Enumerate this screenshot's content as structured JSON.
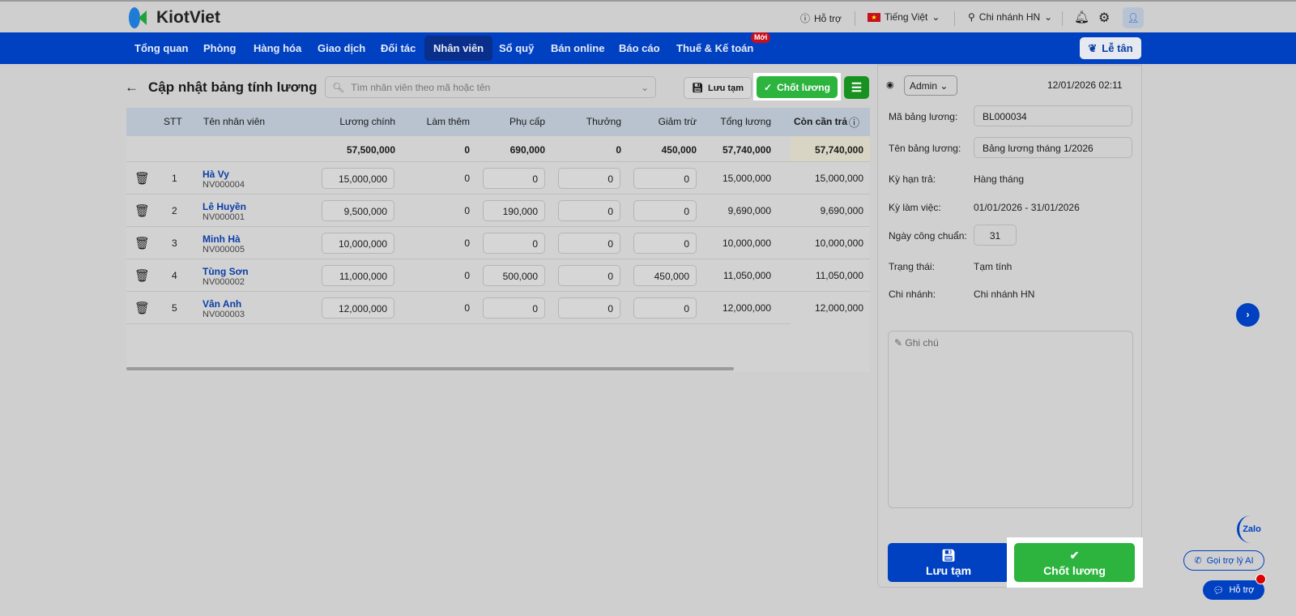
{
  "app": {
    "brand": "KiotViet",
    "support": "Hỗ trợ",
    "language": "Tiếng Việt",
    "branch": "Chi nhánh HN",
    "reception": "Lễ tân"
  },
  "nav": [
    {
      "label": "Tổng quan"
    },
    {
      "label": "Phòng"
    },
    {
      "label": "Hàng hóa"
    },
    {
      "label": "Giao dịch"
    },
    {
      "label": "Đối tác"
    },
    {
      "label": "Nhân viên",
      "active": true
    },
    {
      "label": "Sổ quỹ"
    },
    {
      "label": "Bán online"
    },
    {
      "label": "Báo cáo"
    },
    {
      "label": "Thuế & Kế toán",
      "badge": "Mới"
    }
  ],
  "page": {
    "title": "Cập nhật bảng tính lương",
    "search_placeholder": "Tìm nhân viên theo mã hoặc tên",
    "save_draft": "Lưu tạm",
    "finalize": "Chốt lương"
  },
  "table": {
    "headers": [
      "STT",
      "Tên nhân viên",
      "Lương chính",
      "Làm thêm",
      "Phụ cấp",
      "Thưởng",
      "Giảm trừ",
      "Tổng lương",
      "Còn cần trả"
    ],
    "totals": [
      "57,500,000",
      "0",
      "690,000",
      "0",
      "450,000",
      "57,740,000",
      "57,740,000"
    ],
    "rows": [
      {
        "stt": "1",
        "name": "Hà Vy",
        "code": "NV000004",
        "base": "15,000,000",
        "overtime": "0",
        "allowance": "0",
        "bonus": "0",
        "deduction": "0",
        "total": "15,000,000",
        "due": "15,000,000"
      },
      {
        "stt": "2",
        "name": "Lê Huyền",
        "code": "NV000001",
        "base": "9,500,000",
        "overtime": "0",
        "allowance": "190,000",
        "bonus": "0",
        "deduction": "0",
        "total": "9,690,000",
        "due": "9,690,000"
      },
      {
        "stt": "3",
        "name": "Minh Hà",
        "code": "NV000005",
        "base": "10,000,000",
        "overtime": "0",
        "allowance": "0",
        "bonus": "0",
        "deduction": "0",
        "total": "10,000,000",
        "due": "10,000,000"
      },
      {
        "stt": "4",
        "name": "Tùng Sơn",
        "code": "NV000002",
        "base": "11,000,000",
        "overtime": "0",
        "allowance": "500,000",
        "bonus": "0",
        "deduction": "450,000",
        "total": "11,050,000",
        "due": "11,050,000"
      },
      {
        "stt": "5",
        "name": "Vân Anh",
        "code": "NV000003",
        "base": "12,000,000",
        "overtime": "0",
        "allowance": "0",
        "bonus": "0",
        "deduction": "0",
        "total": "12,000,000",
        "due": "12,000,000"
      }
    ]
  },
  "panel": {
    "user": "Admin",
    "datetime": "12/01/2026 02:11",
    "code_label": "Mã bảng lương:",
    "code": "BL000034",
    "name_label": "Tên bảng lương:",
    "name": "Bảng lương tháng 1/2026",
    "term_label": "Kỳ hạn trả:",
    "term": "Hàng tháng",
    "period_label": "Kỳ làm việc:",
    "period": "01/01/2026 - 31/01/2026",
    "days_label": "Ngày công chuẩn:",
    "days": "31",
    "status_label": "Trạng thái:",
    "status": "Tạm tính",
    "branch_label": "Chi nhánh:",
    "branch": "Chi nhánh HN",
    "note_placeholder": "Ghi chú",
    "save_draft": "Lưu tạm",
    "finalize": "Chốt lương"
  },
  "widgets": {
    "zalo": "Zalo",
    "ai": "Gọi trợ lý AI",
    "support": "Hỗ trợ"
  }
}
